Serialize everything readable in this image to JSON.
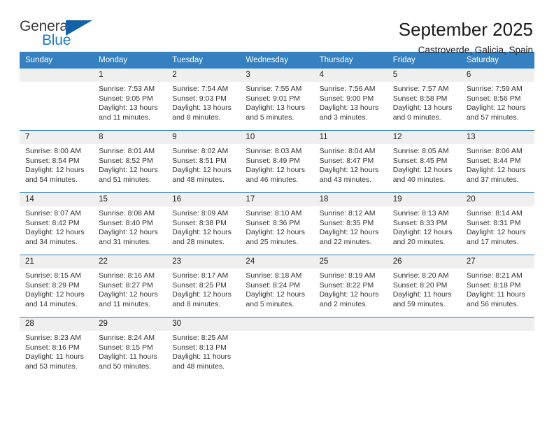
{
  "brand": {
    "name_top": "General",
    "name_bottom": "Blue",
    "triangle_color": "#1461a8",
    "blue_color": "#1f7bc4"
  },
  "header": {
    "month_title": "September 2025",
    "location": "Castroverde, Galicia, Spain"
  },
  "theme": {
    "header_blue": "#3580c0",
    "daynum_band": "#efefef",
    "text": "#333333"
  },
  "weekday_headers": [
    "Sunday",
    "Monday",
    "Tuesday",
    "Wednesday",
    "Thursday",
    "Friday",
    "Saturday"
  ],
  "weeks": [
    [
      {
        "day": "",
        "sunrise": "",
        "sunset": "",
        "daylight_line1": "",
        "daylight_line2": ""
      },
      {
        "day": "1",
        "sunrise": "Sunrise: 7:53 AM",
        "sunset": "Sunset: 9:05 PM",
        "daylight_line1": "Daylight: 13 hours",
        "daylight_line2": "and 11 minutes."
      },
      {
        "day": "2",
        "sunrise": "Sunrise: 7:54 AM",
        "sunset": "Sunset: 9:03 PM",
        "daylight_line1": "Daylight: 13 hours",
        "daylight_line2": "and 8 minutes."
      },
      {
        "day": "3",
        "sunrise": "Sunrise: 7:55 AM",
        "sunset": "Sunset: 9:01 PM",
        "daylight_line1": "Daylight: 13 hours",
        "daylight_line2": "and 5 minutes."
      },
      {
        "day": "4",
        "sunrise": "Sunrise: 7:56 AM",
        "sunset": "Sunset: 9:00 PM",
        "daylight_line1": "Daylight: 13 hours",
        "daylight_line2": "and 3 minutes."
      },
      {
        "day": "5",
        "sunrise": "Sunrise: 7:57 AM",
        "sunset": "Sunset: 8:58 PM",
        "daylight_line1": "Daylight: 13 hours",
        "daylight_line2": "and 0 minutes."
      },
      {
        "day": "6",
        "sunrise": "Sunrise: 7:59 AM",
        "sunset": "Sunset: 8:56 PM",
        "daylight_line1": "Daylight: 12 hours",
        "daylight_line2": "and 57 minutes."
      }
    ],
    [
      {
        "day": "7",
        "sunrise": "Sunrise: 8:00 AM",
        "sunset": "Sunset: 8:54 PM",
        "daylight_line1": "Daylight: 12 hours",
        "daylight_line2": "and 54 minutes."
      },
      {
        "day": "8",
        "sunrise": "Sunrise: 8:01 AM",
        "sunset": "Sunset: 8:52 PM",
        "daylight_line1": "Daylight: 12 hours",
        "daylight_line2": "and 51 minutes."
      },
      {
        "day": "9",
        "sunrise": "Sunrise: 8:02 AM",
        "sunset": "Sunset: 8:51 PM",
        "daylight_line1": "Daylight: 12 hours",
        "daylight_line2": "and 48 minutes."
      },
      {
        "day": "10",
        "sunrise": "Sunrise: 8:03 AM",
        "sunset": "Sunset: 8:49 PM",
        "daylight_line1": "Daylight: 12 hours",
        "daylight_line2": "and 46 minutes."
      },
      {
        "day": "11",
        "sunrise": "Sunrise: 8:04 AM",
        "sunset": "Sunset: 8:47 PM",
        "daylight_line1": "Daylight: 12 hours",
        "daylight_line2": "and 43 minutes."
      },
      {
        "day": "12",
        "sunrise": "Sunrise: 8:05 AM",
        "sunset": "Sunset: 8:45 PM",
        "daylight_line1": "Daylight: 12 hours",
        "daylight_line2": "and 40 minutes."
      },
      {
        "day": "13",
        "sunrise": "Sunrise: 8:06 AM",
        "sunset": "Sunset: 8:44 PM",
        "daylight_line1": "Daylight: 12 hours",
        "daylight_line2": "and 37 minutes."
      }
    ],
    [
      {
        "day": "14",
        "sunrise": "Sunrise: 8:07 AM",
        "sunset": "Sunset: 8:42 PM",
        "daylight_line1": "Daylight: 12 hours",
        "daylight_line2": "and 34 minutes."
      },
      {
        "day": "15",
        "sunrise": "Sunrise: 8:08 AM",
        "sunset": "Sunset: 8:40 PM",
        "daylight_line1": "Daylight: 12 hours",
        "daylight_line2": "and 31 minutes."
      },
      {
        "day": "16",
        "sunrise": "Sunrise: 8:09 AM",
        "sunset": "Sunset: 8:38 PM",
        "daylight_line1": "Daylight: 12 hours",
        "daylight_line2": "and 28 minutes."
      },
      {
        "day": "17",
        "sunrise": "Sunrise: 8:10 AM",
        "sunset": "Sunset: 8:36 PM",
        "daylight_line1": "Daylight: 12 hours",
        "daylight_line2": "and 25 minutes."
      },
      {
        "day": "18",
        "sunrise": "Sunrise: 8:12 AM",
        "sunset": "Sunset: 8:35 PM",
        "daylight_line1": "Daylight: 12 hours",
        "daylight_line2": "and 22 minutes."
      },
      {
        "day": "19",
        "sunrise": "Sunrise: 8:13 AM",
        "sunset": "Sunset: 8:33 PM",
        "daylight_line1": "Daylight: 12 hours",
        "daylight_line2": "and 20 minutes."
      },
      {
        "day": "20",
        "sunrise": "Sunrise: 8:14 AM",
        "sunset": "Sunset: 8:31 PM",
        "daylight_line1": "Daylight: 12 hours",
        "daylight_line2": "and 17 minutes."
      }
    ],
    [
      {
        "day": "21",
        "sunrise": "Sunrise: 8:15 AM",
        "sunset": "Sunset: 8:29 PM",
        "daylight_line1": "Daylight: 12 hours",
        "daylight_line2": "and 14 minutes."
      },
      {
        "day": "22",
        "sunrise": "Sunrise: 8:16 AM",
        "sunset": "Sunset: 8:27 PM",
        "daylight_line1": "Daylight: 12 hours",
        "daylight_line2": "and 11 minutes."
      },
      {
        "day": "23",
        "sunrise": "Sunrise: 8:17 AM",
        "sunset": "Sunset: 8:25 PM",
        "daylight_line1": "Daylight: 12 hours",
        "daylight_line2": "and 8 minutes."
      },
      {
        "day": "24",
        "sunrise": "Sunrise: 8:18 AM",
        "sunset": "Sunset: 8:24 PM",
        "daylight_line1": "Daylight: 12 hours",
        "daylight_line2": "and 5 minutes."
      },
      {
        "day": "25",
        "sunrise": "Sunrise: 8:19 AM",
        "sunset": "Sunset: 8:22 PM",
        "daylight_line1": "Daylight: 12 hours",
        "daylight_line2": "and 2 minutes."
      },
      {
        "day": "26",
        "sunrise": "Sunrise: 8:20 AM",
        "sunset": "Sunset: 8:20 PM",
        "daylight_line1": "Daylight: 11 hours",
        "daylight_line2": "and 59 minutes."
      },
      {
        "day": "27",
        "sunrise": "Sunrise: 8:21 AM",
        "sunset": "Sunset: 8:18 PM",
        "daylight_line1": "Daylight: 11 hours",
        "daylight_line2": "and 56 minutes."
      }
    ],
    [
      {
        "day": "28",
        "sunrise": "Sunrise: 8:23 AM",
        "sunset": "Sunset: 8:16 PM",
        "daylight_line1": "Daylight: 11 hours",
        "daylight_line2": "and 53 minutes."
      },
      {
        "day": "29",
        "sunrise": "Sunrise: 8:24 AM",
        "sunset": "Sunset: 8:15 PM",
        "daylight_line1": "Daylight: 11 hours",
        "daylight_line2": "and 50 minutes."
      },
      {
        "day": "30",
        "sunrise": "Sunrise: 8:25 AM",
        "sunset": "Sunset: 8:13 PM",
        "daylight_line1": "Daylight: 11 hours",
        "daylight_line2": "and 48 minutes."
      },
      {
        "day": "",
        "sunrise": "",
        "sunset": "",
        "daylight_line1": "",
        "daylight_line2": ""
      },
      {
        "day": "",
        "sunrise": "",
        "sunset": "",
        "daylight_line1": "",
        "daylight_line2": ""
      },
      {
        "day": "",
        "sunrise": "",
        "sunset": "",
        "daylight_line1": "",
        "daylight_line2": ""
      },
      {
        "day": "",
        "sunrise": "",
        "sunset": "",
        "daylight_line1": "",
        "daylight_line2": ""
      }
    ]
  ]
}
